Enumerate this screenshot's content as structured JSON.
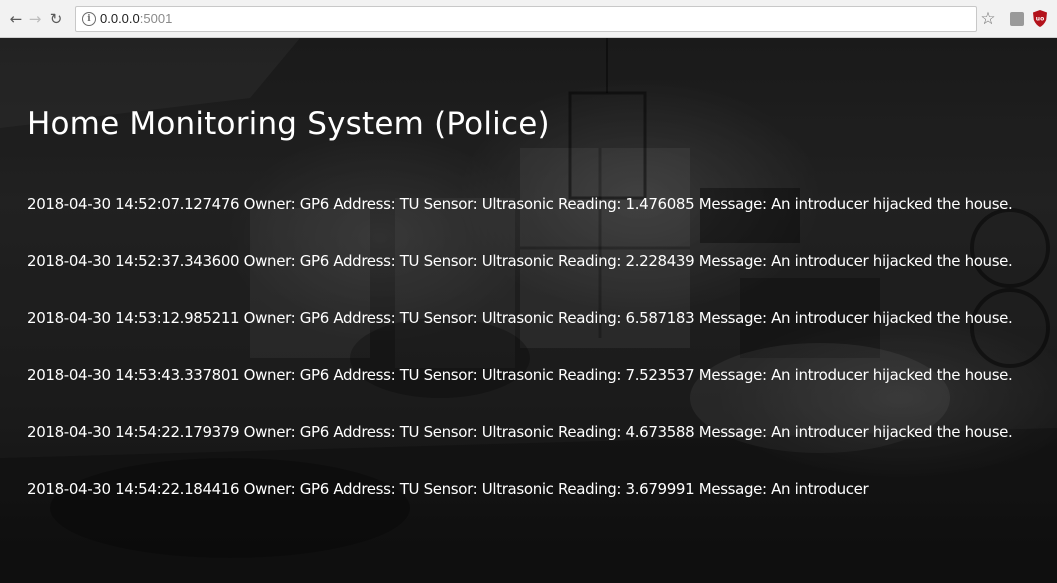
{
  "browser": {
    "url_host": "0.0.0.0",
    "url_port": ":5001"
  },
  "page": {
    "title": "Home Monitoring System (Police)",
    "entries": [
      "2018-04-30 14:52:07.127476 Owner: GP6 Address: TU Sensor: Ultrasonic Reading: 1.476085 Message: An introducer hijacked the house.",
      "2018-04-30 14:52:37.343600 Owner: GP6 Address: TU Sensor: Ultrasonic Reading: 2.228439 Message: An introducer hijacked the house.",
      "2018-04-30 14:53:12.985211 Owner: GP6 Address: TU Sensor: Ultrasonic Reading: 6.587183 Message: An introducer hijacked the house.",
      "2018-04-30 14:53:43.337801 Owner: GP6 Address: TU Sensor: Ultrasonic Reading: 7.523537 Message: An introducer hijacked the house.",
      "2018-04-30 14:54:22.179379 Owner: GP6 Address: TU Sensor: Ultrasonic Reading: 4.673588 Message: An introducer hijacked the house.",
      "2018-04-30 14:54:22.184416 Owner: GP6 Address: TU Sensor: Ultrasonic Reading: 3.679991 Message: An introducer"
    ]
  }
}
